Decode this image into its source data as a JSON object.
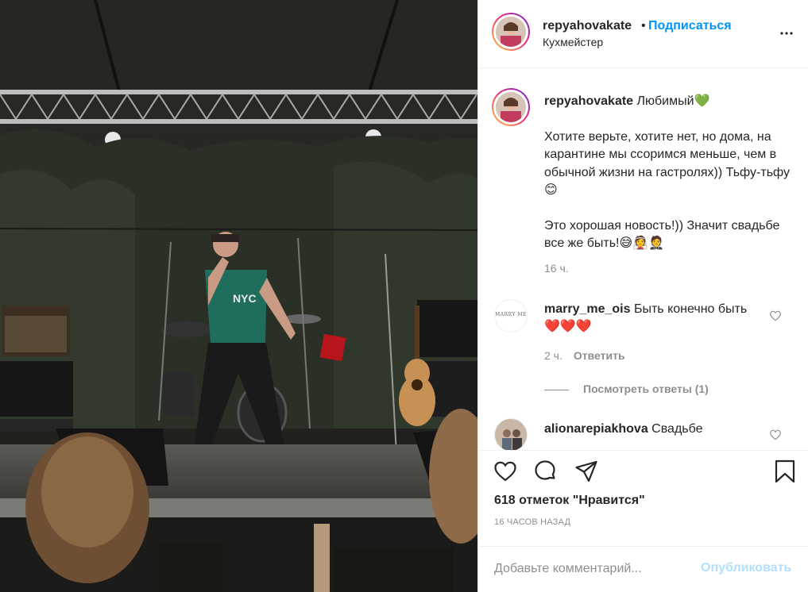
{
  "post": {
    "author": "repyahovakate",
    "separator": "•",
    "follow_label": "Подписаться",
    "location": "Кухмейстер"
  },
  "caption": {
    "user": "repyahovakate",
    "line1_text": " Любимый",
    "line1_emoji": "💚",
    "para1": "Хотите верьте, хотите нет, но дома, на карантине мы ссоримся меньше, чем в обычной жизни на гастролях)) Тьфу-тьфу😊",
    "para2": "Это хорошая новость!)) Значит свадьбе все же быть!😅👰🤵",
    "time": "16 ч."
  },
  "comments": [
    {
      "user": "marry_me_ois",
      "avatar_text": "MARRY ME",
      "text": " Быть конечно быть❤️❤️❤️",
      "time": "2 ч.",
      "reply_label": "Ответить",
      "view_replies": "Посмотреть ответы (1)"
    },
    {
      "user": "alionarepiakhova",
      "text": " Свадьбе"
    }
  ],
  "actions": {
    "likes": "618 отметок \"Нравится\"",
    "time_ago": "16 ЧАСОВ НАЗАД"
  },
  "comment_box": {
    "placeholder": "Добавьте комментарий...",
    "publish_label": "Опубликовать"
  },
  "colors": {
    "accent": "#0095f6",
    "publish_disabled": "#b2dffc",
    "muted": "#8e8e8e"
  },
  "photo_text": {
    "shirt": "NYC"
  }
}
